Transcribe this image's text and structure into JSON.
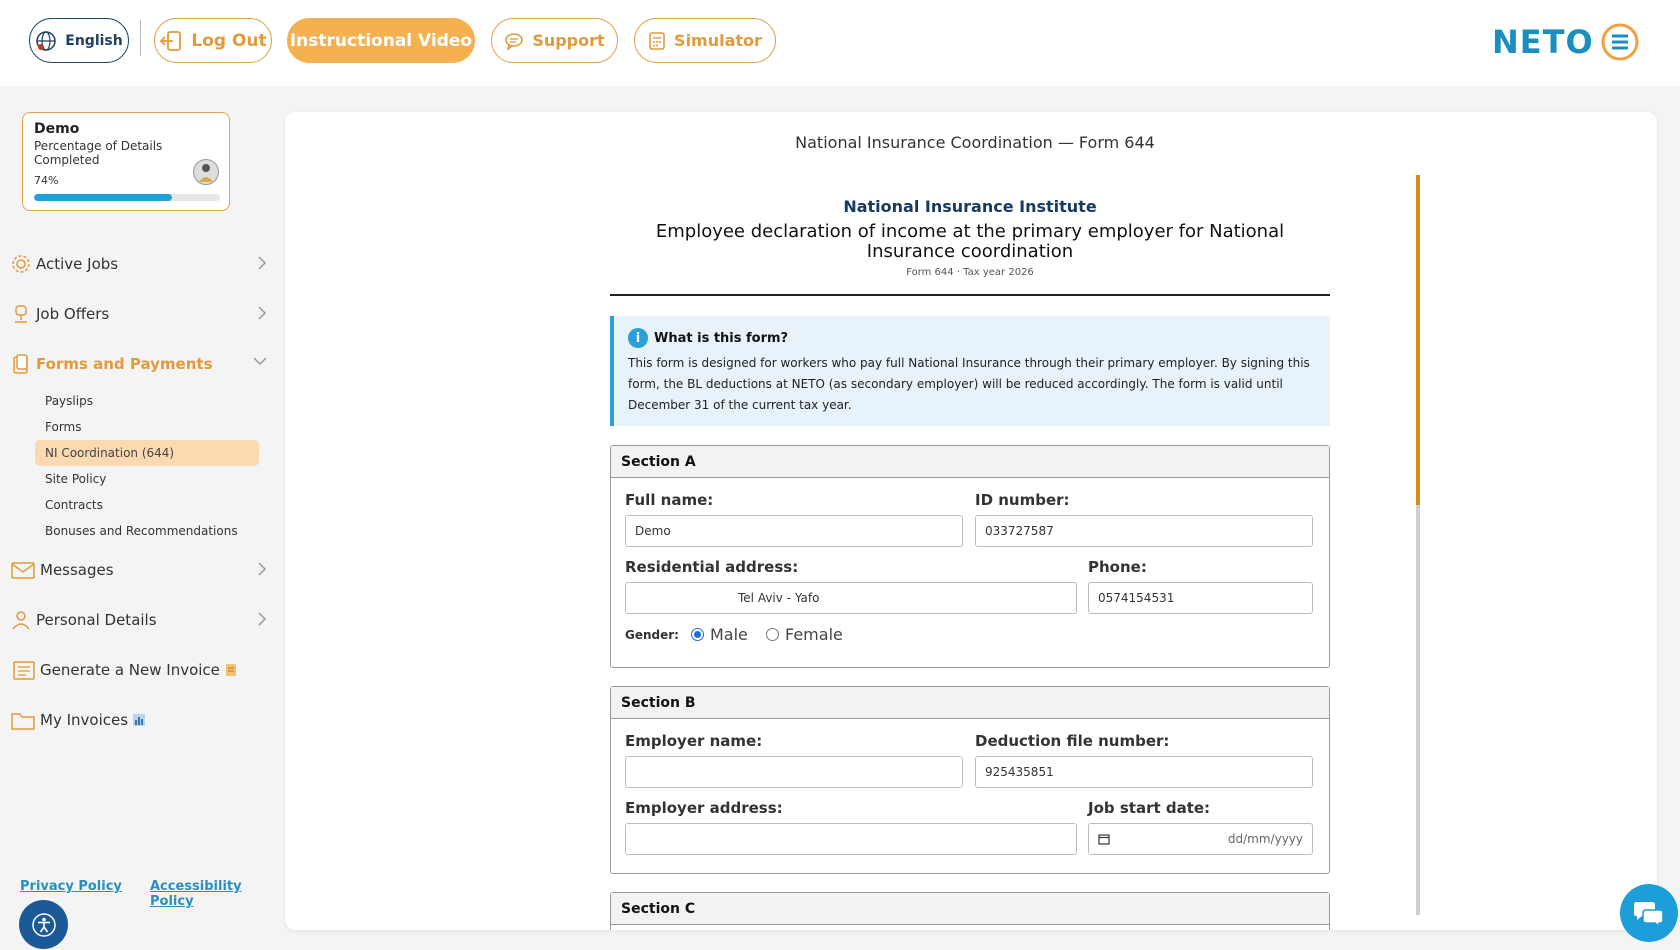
{
  "topbar": {
    "language_label": "English",
    "logout_label": "Log Out",
    "video_label": "Instructional Video",
    "support_label": "Support",
    "simulator_label": "Simulator",
    "logo_text": "NETO"
  },
  "profile": {
    "name": "Demo",
    "subtitle": "Percentage of Details Completed",
    "percent_label": "74%",
    "percent_value": 0.74
  },
  "sidebar": {
    "items": [
      {
        "label": "Active Jobs"
      },
      {
        "label": "Job Offers"
      },
      {
        "label": "Forms and Payments"
      },
      {
        "label": "Messages"
      },
      {
        "label": "Personal Details"
      },
      {
        "label": "Generate a New Invoice"
      },
      {
        "label": "My Invoices"
      }
    ],
    "subitems": [
      {
        "label": "Payslips"
      },
      {
        "label": "Forms"
      },
      {
        "label": "NI Coordination (644)"
      },
      {
        "label": "Site Policy"
      },
      {
        "label": "Contracts"
      },
      {
        "label": "Bonuses and Recommendations"
      }
    ],
    "privacy_label": "Privacy Policy",
    "accessibility_label": "Accessibility Policy"
  },
  "page": {
    "title": "National Insurance Coordination — Form 644"
  },
  "form": {
    "institute": "National Insurance Institute",
    "title": "Employee declaration of income at the primary employer for National Insurance coordination",
    "meta": "Form 644 · Tax year 2026",
    "info": {
      "heading": "What is this form?",
      "body": "This form is designed for workers who pay full National Insurance through their primary employer. By signing this form, the BL deductions at NETO (as secondary employer) will be reduced accordingly. The form is valid until December 31 of the current tax year."
    },
    "section_a": {
      "heading": "Section A",
      "full_name_label": "Full name:",
      "full_name_value": "Demo",
      "id_label": "ID number:",
      "id_value": "033727587",
      "address_label": "Residential address:",
      "address_value": "Tel Aviv - Yafo",
      "phone_label": "Phone:",
      "phone_value": "0574154531",
      "gender_label": "Gender:",
      "gender_male": "Male",
      "gender_female": "Female"
    },
    "section_b": {
      "heading": "Section B",
      "employer_name_label": "Employer name:",
      "employer_name_value": "",
      "deduction_label": "Deduction file number:",
      "deduction_value": "925435851",
      "employer_address_label": "Employer address:",
      "employer_address_value": "",
      "start_date_label": "Job start date:",
      "start_date_placeholder": "dd/mm/yyyy"
    },
    "section_c": {
      "heading": "Section C"
    }
  }
}
